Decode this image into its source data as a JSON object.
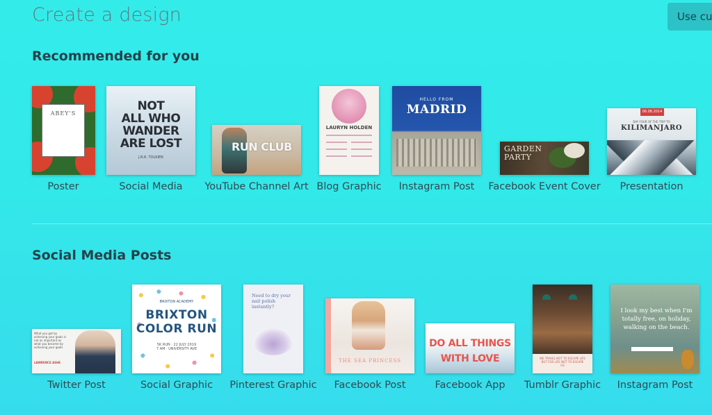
{
  "header": {
    "title": "Create a design",
    "custom_button_label": "Use cus"
  },
  "sections": [
    {
      "title": "Recommended for you",
      "items": [
        {
          "label": "Poster",
          "thumb_text": [
            "ABEY'S"
          ]
        },
        {
          "label": "Social Media",
          "thumb_text": [
            "NOT",
            "ALL WHO",
            "WANDER",
            "ARE LOST",
            "J.R.R. TOLKIEN"
          ]
        },
        {
          "label": "YouTube Channel Art",
          "thumb_text": [
            "RUN CLUB"
          ]
        },
        {
          "label": "Blog Graphic",
          "thumb_text": [
            "LAURYN HOLDEN"
          ]
        },
        {
          "label": "Instagram Post",
          "thumb_text": [
            "HELLO FROM",
            "MADRID"
          ]
        },
        {
          "label": "Facebook Event Cover",
          "thumb_text": [
            "GARDEN",
            "PARTY"
          ]
        },
        {
          "label": "Presentation",
          "thumb_text": [
            "06.08.2014",
            "DAY FOUR OF THE TRIP TO",
            "KILIMANJARO"
          ]
        }
      ]
    },
    {
      "title": "Social Media Posts",
      "items": [
        {
          "label": "Twitter Post",
          "thumb_text": [
            "What you get by achieving your goals is not as important as what you become by achieving your goals",
            "LAWRENCE ASHE"
          ]
        },
        {
          "label": "Social Graphic",
          "thumb_text": [
            "BRIXTON ACADEMY",
            "BRIXTON",
            "COLOR RUN",
            "5K RUN · 22 JULY 2019",
            "7 AM · UNIVERSITY AVE"
          ]
        },
        {
          "label": "Pinterest Graphic",
          "thumb_text": [
            "Need to dry your nail polish instantly?"
          ]
        },
        {
          "label": "Facebook Post",
          "thumb_text": [
            "THE SEA PRINCESS"
          ]
        },
        {
          "label": "Facebook App",
          "thumb_text": [
            "DO ALL THINGS",
            "WITH LOVE"
          ]
        },
        {
          "label": "Tumblr Graphic",
          "thumb_text": [
            "WE TRAVEL NOT TO ESCAPE LIFE BUT FOR LIFE NOT TO ESCAPE US"
          ]
        },
        {
          "label": "Instagram Post",
          "thumb_text": [
            "I look my best when I'm totally free, on holiday, walking on the beach."
          ]
        }
      ]
    }
  ],
  "colors": {
    "background": "#33ecea",
    "accent_button": "#2cc2c7",
    "heading": "#26424a"
  }
}
